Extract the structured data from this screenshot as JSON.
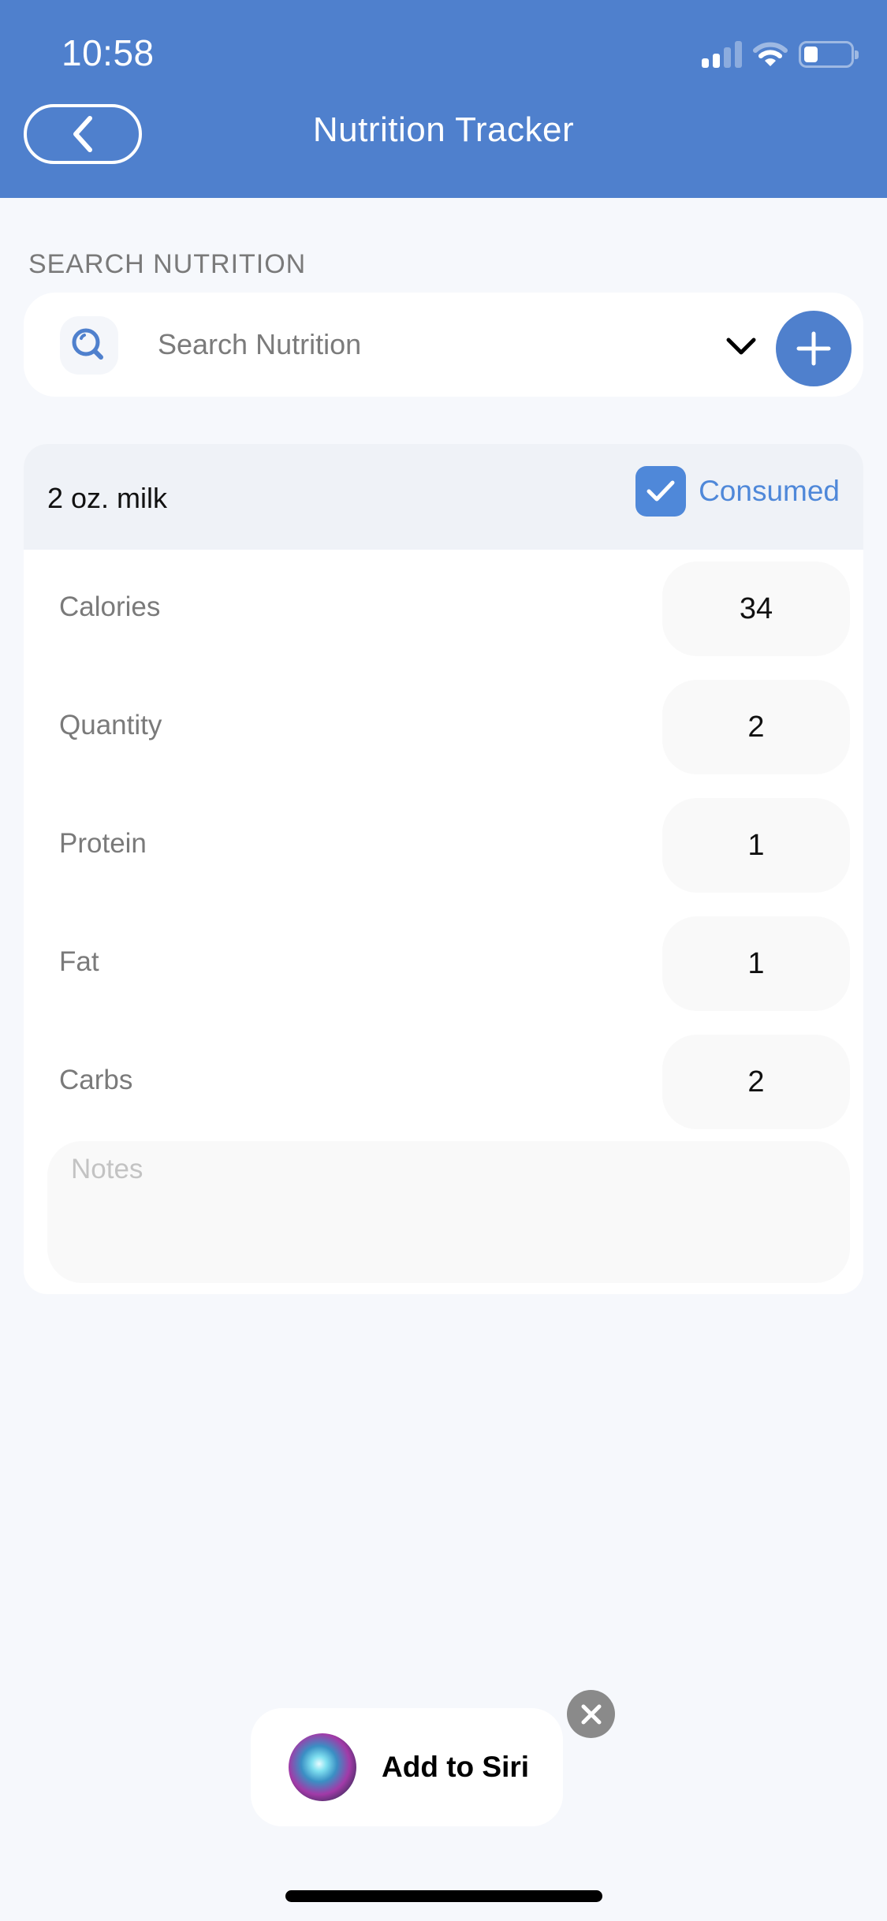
{
  "status_bar": {
    "time": "10:58",
    "signal_bars": 2,
    "signal_bars_total": 4,
    "battery_percent": 30
  },
  "nav": {
    "back_icon": "chevron-left-icon",
    "title": "Nutrition Tracker"
  },
  "search": {
    "section_label": "SEARCH NUTRITION",
    "placeholder": "Search Nutrition",
    "value": "",
    "icon": "search-icon",
    "dropdown_icon": "chevron-down-icon",
    "add_icon": "plus-icon"
  },
  "entry": {
    "name": "2 oz. milk",
    "consumed_label": "Consumed",
    "consumed": true,
    "accent_color": "#4f88d9",
    "fields": [
      {
        "label": "Calories",
        "value": "34"
      },
      {
        "label": "Quantity",
        "value": "2"
      },
      {
        "label": "Protein",
        "value": "1"
      },
      {
        "label": "Fat",
        "value": "1"
      },
      {
        "label": "Carbs",
        "value": "2"
      }
    ],
    "notes_placeholder": "Notes",
    "notes_value": ""
  },
  "siri": {
    "label": "Add to Siri",
    "icon": "siri-icon",
    "close_icon": "close-icon"
  },
  "colors": {
    "header": "#4f80cd",
    "background": "#f6f8fc"
  }
}
